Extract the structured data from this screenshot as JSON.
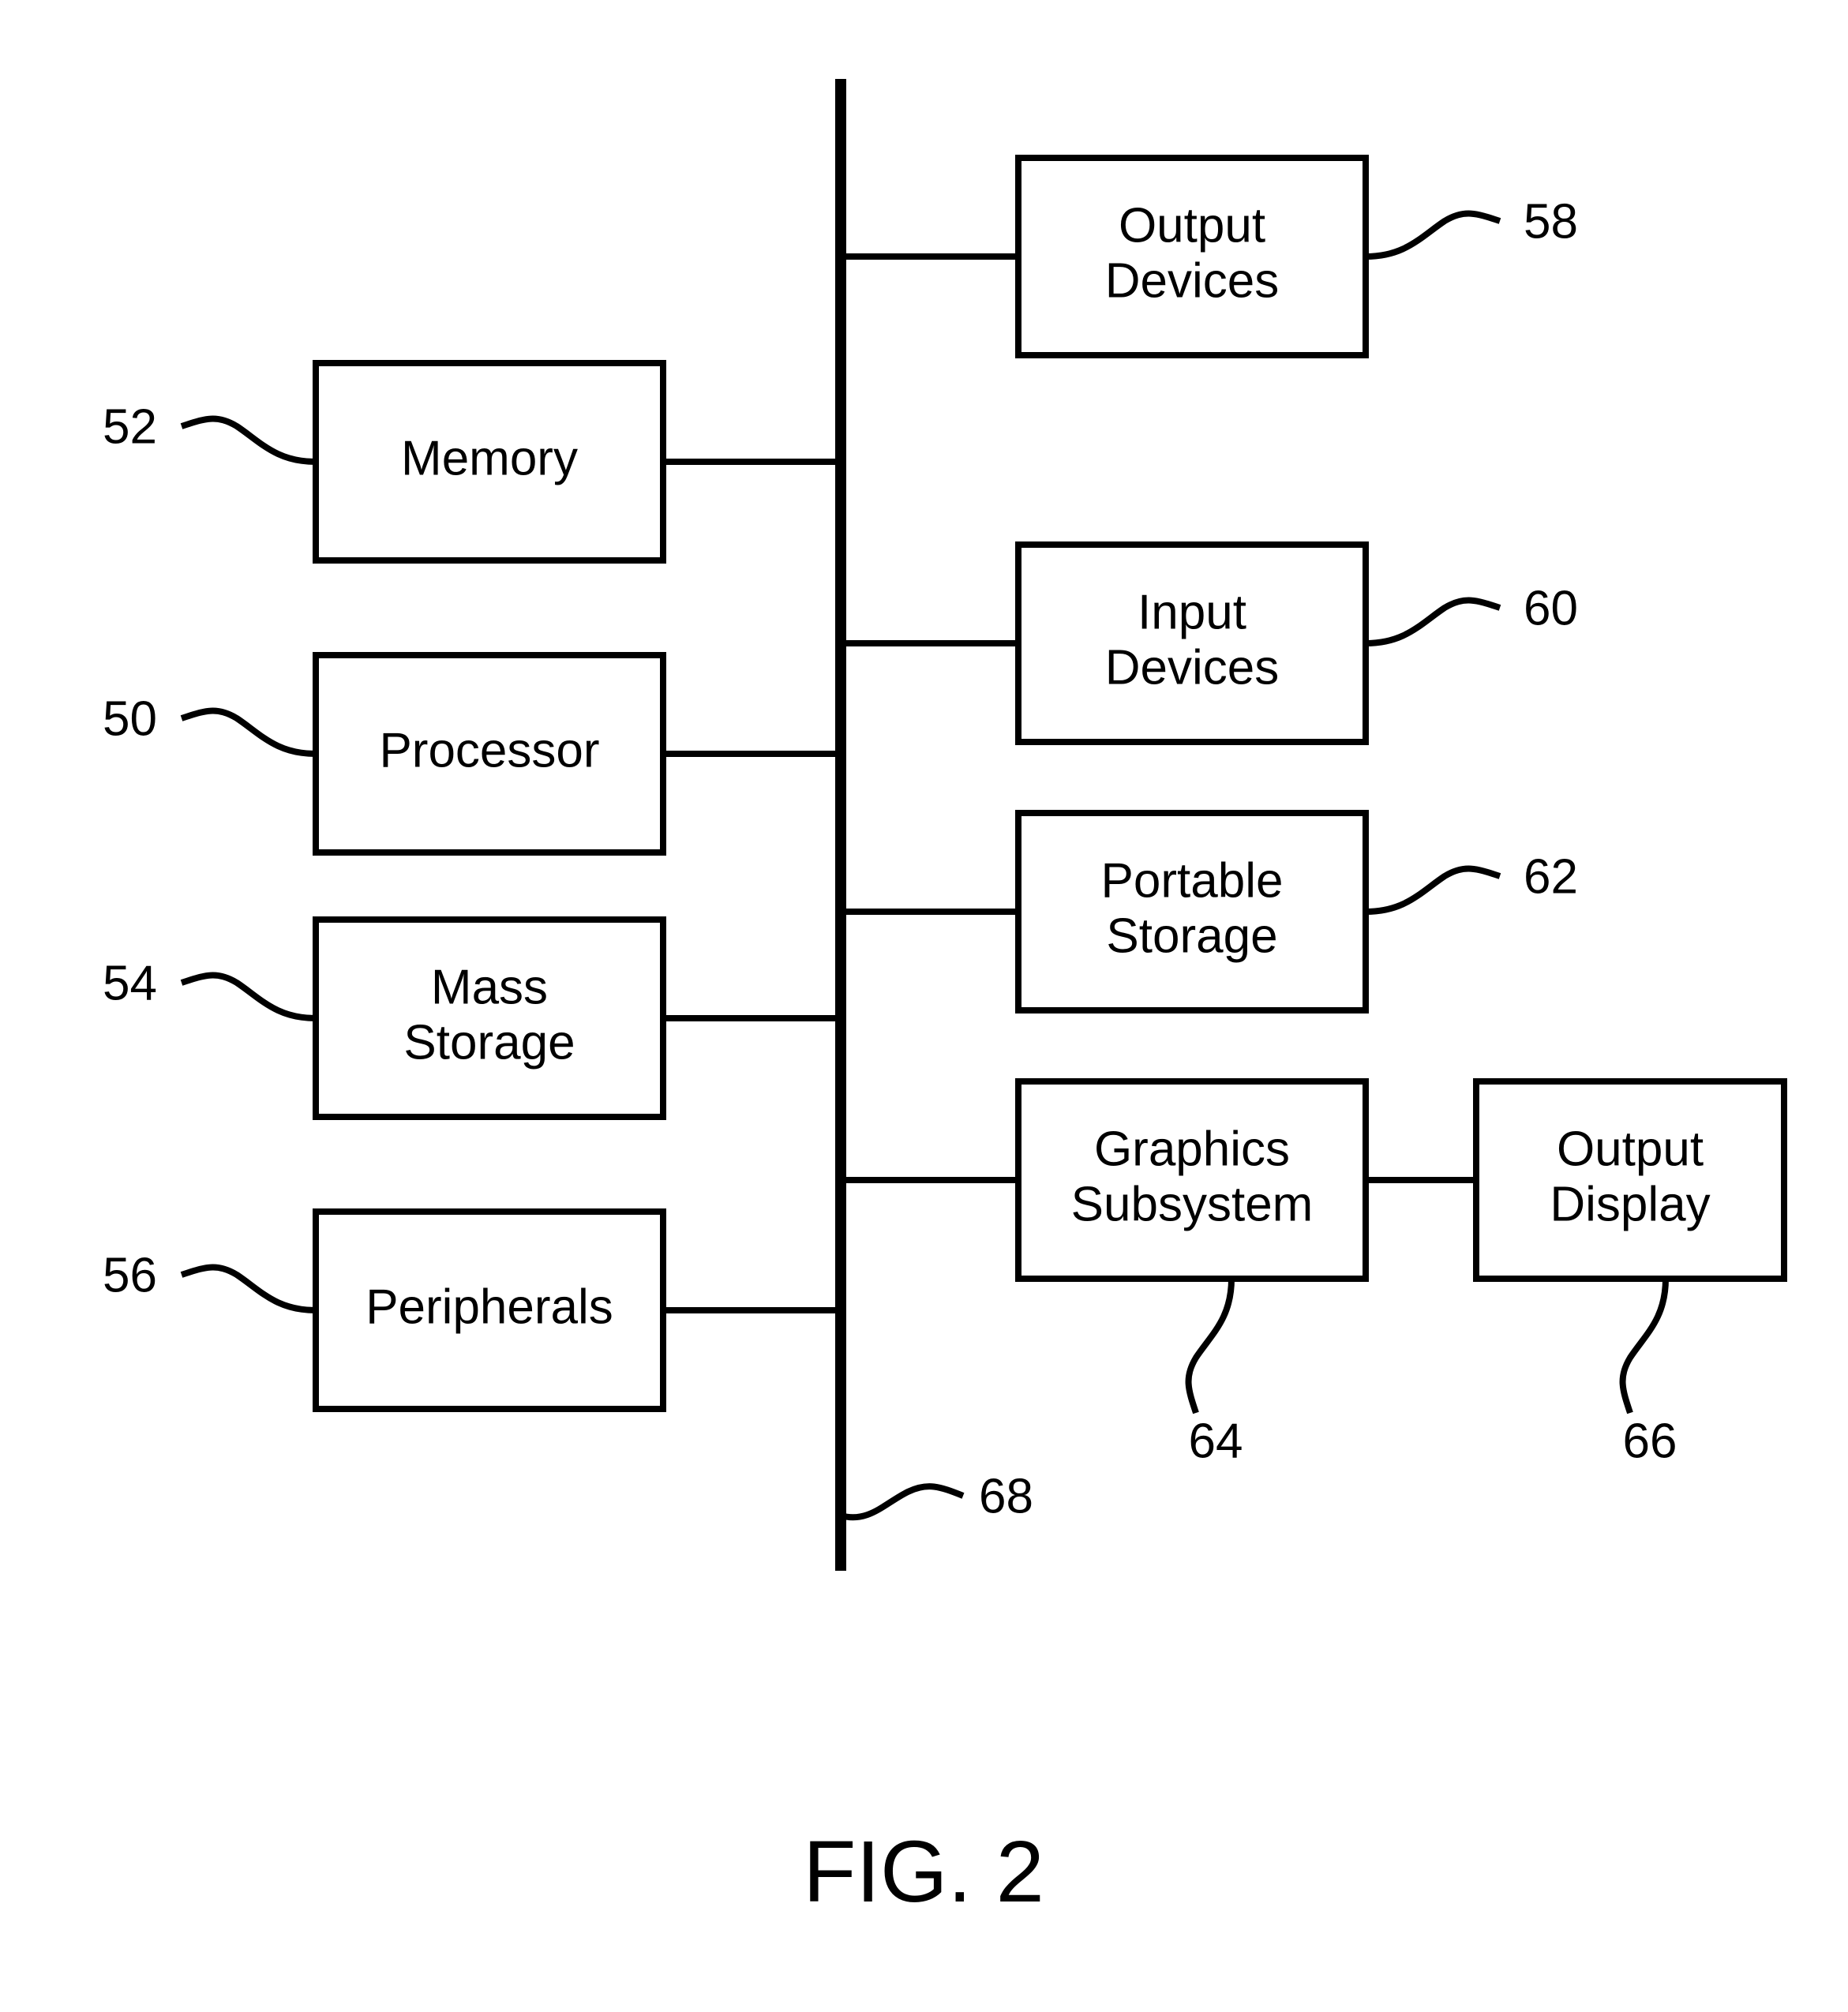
{
  "figure_caption": "FIG. 2",
  "bus_ref": "68",
  "blocks": {
    "memory": {
      "label": "Memory",
      "ref": "52"
    },
    "processor": {
      "label": "Processor",
      "ref": "50"
    },
    "mass_storage": {
      "label1": "Mass",
      "label2": "Storage",
      "ref": "54"
    },
    "peripherals": {
      "label": "Peripherals",
      "ref": "56"
    },
    "output_devices": {
      "label1": "Output",
      "label2": "Devices",
      "ref": "58"
    },
    "input_devices": {
      "label1": "Input",
      "label2": "Devices",
      "ref": "60"
    },
    "portable_storage": {
      "label1": "Portable",
      "label2": "Storage",
      "ref": "62"
    },
    "graphics": {
      "label1": "Graphics",
      "label2": "Subsystem",
      "ref": "64"
    },
    "output_display": {
      "label1": "Output",
      "label2": "Display",
      "ref": "66"
    }
  }
}
